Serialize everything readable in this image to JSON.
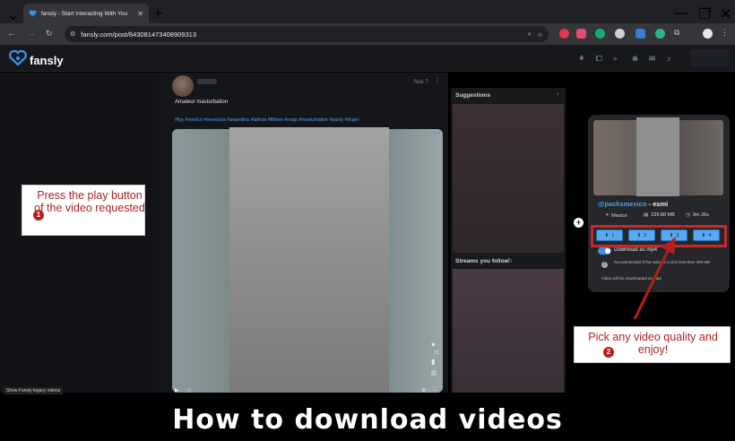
{
  "browser": {
    "tab_title": "fansly - Start Interacting With You",
    "url": "fansly.com/post/843081473408909313"
  },
  "site": {
    "logo_text": "fansly"
  },
  "post": {
    "caption": "Amateur masturbation",
    "date": "Nov 7",
    "tags": "#fyp #mexico #mexicana #argentina #latinas #fifteen #nopp #masturbation #panty #finger",
    "like_count": "21"
  },
  "sidebar": {
    "suggestions_title": "Suggestions",
    "streams_title": "Streams you follow"
  },
  "extension": {
    "handle": "@packsmexico",
    "handle_suffix": " - esmi",
    "country": "Mexico",
    "size": "239.88 MB",
    "duration": "9m 26s",
    "quality_buttons": [
      "1",
      "2",
      "3",
      "4"
    ],
    "mp4_label": "Download as mp4",
    "recommend_note": "Recommended if the video is a size less than 300 MB",
    "downloaded_note": "Video will be downloaded as mp4"
  },
  "annotations": {
    "step1_number": "1",
    "step1_text": "Press the play button of the video requested",
    "step2_number": "2",
    "step2_text": "Pick any video quality and enjoy!",
    "legacy_button": "Show Fansly legacy videos"
  },
  "headline": "How to download videos",
  "colors": {
    "accent": "#4aa3f0",
    "annotation_red": "#b51f1f",
    "quality_button": "#5aa7f2"
  }
}
